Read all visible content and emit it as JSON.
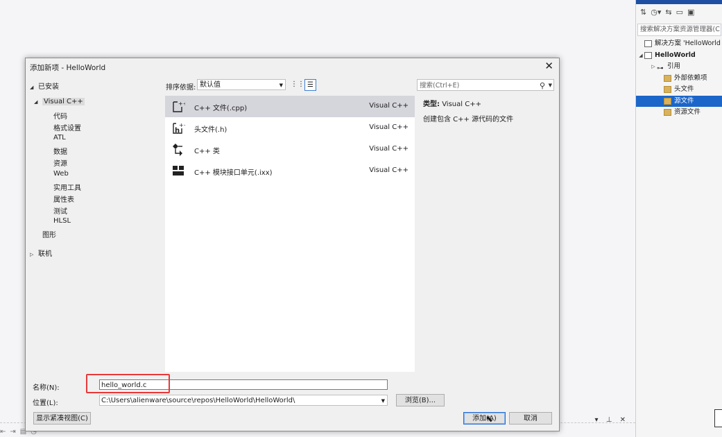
{
  "solution_explorer": {
    "toolbar_icons": [
      "sync-icon",
      "history-icon",
      "arrows-icon",
      "collapse-icon",
      "views-icon"
    ],
    "search_placeholder": "搜索解决方案资源管理器(C",
    "tree": [
      {
        "label": "解决方案 'HelloWorld",
        "icon": "solution-icon"
      },
      {
        "label": "HelloWorld",
        "icon": "project-icon",
        "bold": true,
        "expanded": true
      },
      {
        "label": "引用",
        "icon": "references-icon"
      },
      {
        "label": "外部依赖项",
        "icon": "folder-icon"
      },
      {
        "label": "头文件",
        "icon": "folder-icon"
      },
      {
        "label": "源文件",
        "icon": "folder-icon",
        "selected": true
      },
      {
        "label": "资源文件",
        "icon": "folder-icon"
      }
    ]
  },
  "dialog": {
    "title": "添加新项 - HelloWorld",
    "close_label": "✕",
    "installed_label": "已安装",
    "categories": {
      "root": "Visual C++",
      "children": [
        "代码",
        "格式设置",
        "ATL",
        "数据",
        "资源",
        "Web",
        "实用工具",
        "属性表",
        "测试",
        "HLSL"
      ],
      "graphics": "图形",
      "online": "联机"
    },
    "sort": {
      "label": "排序依据:",
      "value": "默认值"
    },
    "templates": [
      {
        "name": "C++ 文件(.cpp)",
        "lang": "Visual C++",
        "icon": "cpp-file-icon",
        "selected": true
      },
      {
        "name": "头文件(.h)",
        "lang": "Visual C++",
        "icon": "header-file-icon"
      },
      {
        "name": "C++ 类",
        "lang": "Visual C++",
        "icon": "class-icon"
      },
      {
        "name": "C++ 模块接口单元(.ixx)",
        "lang": "Visual C++",
        "icon": "module-icon"
      }
    ],
    "search_placeholder": "搜索(Ctrl+E)",
    "description": {
      "type_label": "类型:",
      "type_value": "Visual C++",
      "text": "创建包含 C++ 源代码的文件"
    },
    "name_label": "名称(N):",
    "name_value": "hello_world.c",
    "location_label": "位置(L):",
    "location_value": "C:\\Users\\alienware\\source\\repos\\HelloWorld\\HelloWorld\\",
    "browse_label": "浏览(B)...",
    "compact_view_label": "显示紧凑视图(C)",
    "add_label": "添加(A)",
    "cancel_label": "取消"
  }
}
